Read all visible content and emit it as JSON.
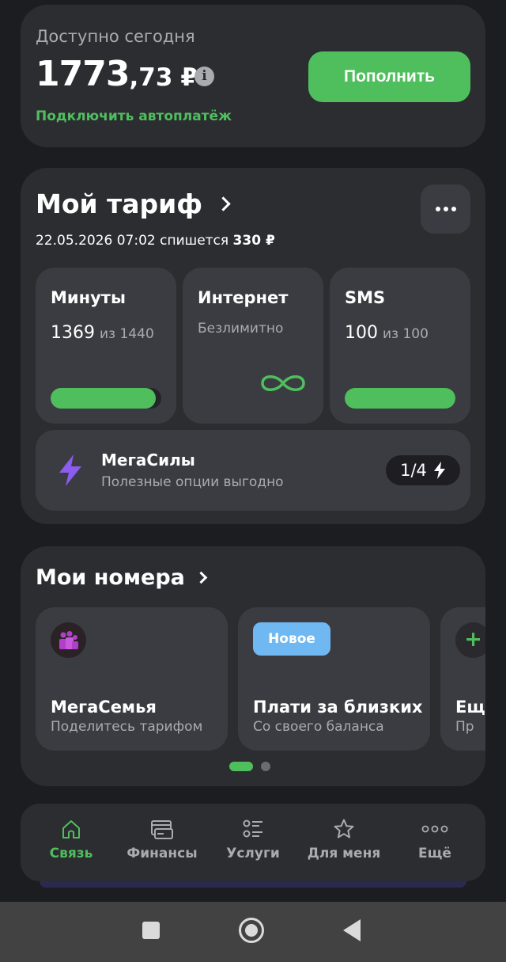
{
  "balance": {
    "label": "Доступно сегодня",
    "amount_int": "1773",
    "amount_frac": ",73",
    "currency": "₽",
    "autopay_link": "Подключить автоплатёж",
    "topup_button": "Пополнить"
  },
  "tariff": {
    "title": "Мой тариф",
    "charge_text": "22.05.2026 07:02 спишется",
    "charge_amount": "330 ₽",
    "minutes": {
      "label": "Минуты",
      "value": "1369",
      "total": "из 1440",
      "fraction": 0.95
    },
    "internet": {
      "label": "Интернет",
      "value": "Безлимитно"
    },
    "sms": {
      "label": "SMS",
      "value": "100",
      "total": "из 100",
      "fraction": 1.0
    },
    "megasily": {
      "title": "МегаСилы",
      "subtitle": "Полезные опции выгодно",
      "badge": "1/4"
    }
  },
  "numbers": {
    "title": "Мои номера",
    "cards": [
      {
        "title": "МегаСемья",
        "subtitle": "Поделитесь тарифом"
      },
      {
        "badge": "Новое",
        "title": "Плати за близких",
        "subtitle": "Со своего баланса"
      },
      {
        "title": "Ещё",
        "subtitle": "Пр"
      }
    ]
  },
  "nav": {
    "items": [
      {
        "label": "Связь",
        "icon": "home-icon",
        "active": true
      },
      {
        "label": "Финансы",
        "icon": "card-icon"
      },
      {
        "label": "Услуги",
        "icon": "services-list-icon"
      },
      {
        "label": "Для меня",
        "icon": "star-icon"
      },
      {
        "label": "Ещё",
        "icon": "more-dots-icon"
      }
    ]
  },
  "colors": {
    "accent": "#4fbf5e",
    "card": "#2c2d31",
    "tile": "#3b3c41",
    "badge_blue": "#6fb8f1",
    "mega_purple": "#8c5bf0"
  }
}
